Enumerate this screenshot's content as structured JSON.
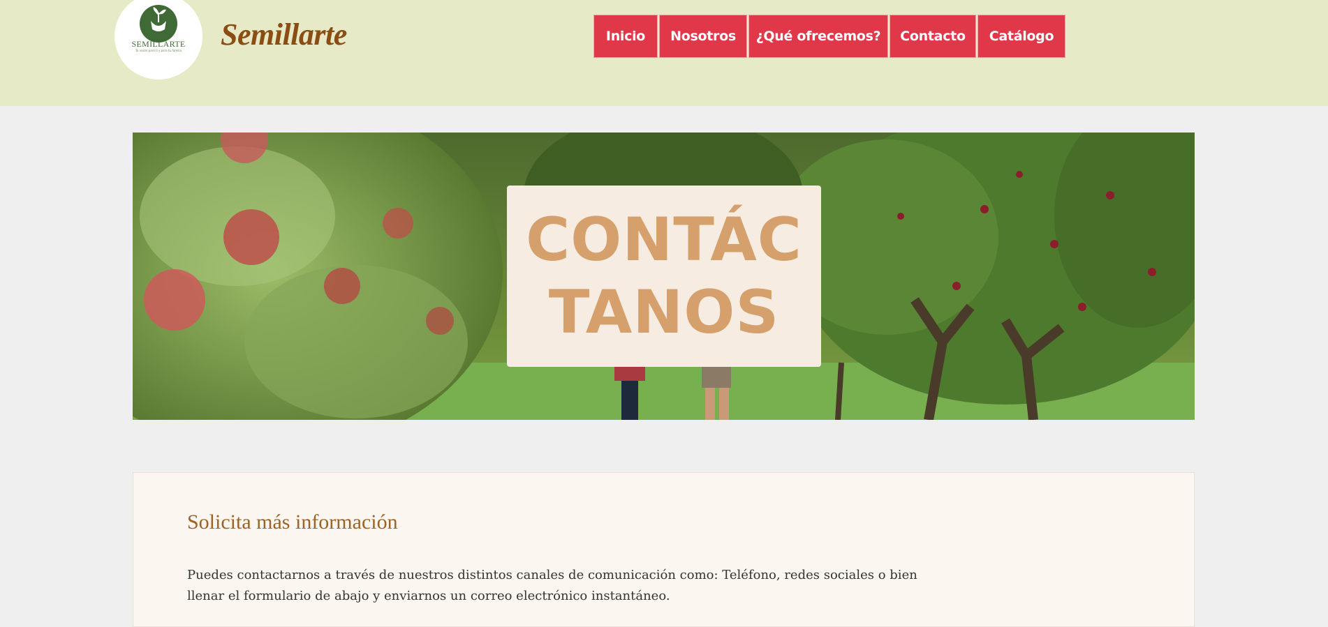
{
  "header": {
    "logo_word": "SEMILLARTE",
    "logo_tagline": "Tu visión para tí y para tu familia",
    "brand_name": "Semillarte"
  },
  "nav": {
    "items": [
      {
        "label": "Inicio"
      },
      {
        "label": "Nosotros"
      },
      {
        "label": "¿Qué ofrecemos?"
      },
      {
        "label": "Contacto"
      },
      {
        "label": "Catálogo"
      }
    ]
  },
  "hero": {
    "title_line1": "CONTÁC",
    "title_line2": "TANOS"
  },
  "info": {
    "title": "Solicita más información",
    "body": "Puedes contactarnos a través de nuestros distintos canales de comunicación como: Teléfono, redes sociales o bien llenar el formulario de abajo y enviarnos un correo electrónico instantáneo."
  },
  "colors": {
    "header_bg": "#e6eac6",
    "nav_bg": "#e03848",
    "brand": "#8a4d14",
    "hero_card_bg": "#f7ece2",
    "hero_text": "#d6a06c",
    "info_title": "#9c6226"
  }
}
